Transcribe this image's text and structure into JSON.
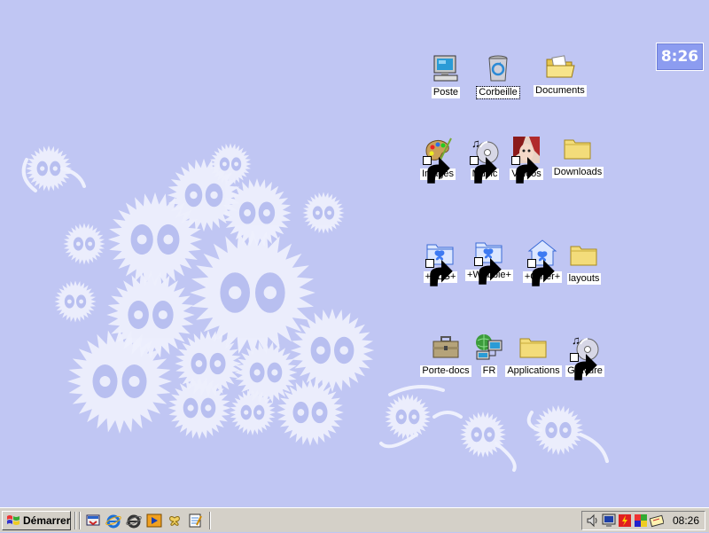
{
  "desktop": {
    "background_color": "#c0c6f3",
    "clock_widget": {
      "time": "8:26"
    },
    "icons": [
      {
        "id": "poste",
        "label": "Poste",
        "icon": "computer-icon",
        "shortcut": false
      },
      {
        "id": "corbeille",
        "label": "Corbeille",
        "icon": "recycle-bin-icon",
        "shortcut": false,
        "focused": true
      },
      {
        "id": "documents",
        "label": "Documents",
        "icon": "folder-open-icon",
        "shortcut": false
      },
      {
        "id": "images",
        "label": "Images",
        "icon": "palette-icon",
        "shortcut": true
      },
      {
        "id": "music",
        "label": "Music",
        "icon": "music-cd-icon",
        "shortcut": true
      },
      {
        "id": "videos",
        "label": "Videos",
        "icon": "video-face-icon",
        "shortcut": true
      },
      {
        "id": "downloads",
        "label": "Downloads",
        "icon": "folder-icon",
        "shortcut": false
      },
      {
        "id": "slg",
        "label": "+SLG+",
        "icon": "butterfly-folder-icon",
        "shortcut": true
      },
      {
        "id": "webbie",
        "label": "+Webbie+",
        "icon": "butterfly-folder-icon",
        "shortcut": true
      },
      {
        "id": "other",
        "label": "+Other+",
        "icon": "butterfly-home-icon",
        "shortcut": true
      },
      {
        "id": "layouts",
        "label": "layouts",
        "icon": "folder-icon",
        "shortcut": false
      },
      {
        "id": "porte-docs",
        "label": "Porte-docs",
        "icon": "briefcase-icon",
        "shortcut": false
      },
      {
        "id": "fr",
        "label": "FR",
        "icon": "network-icon",
        "shortcut": false
      },
      {
        "id": "applications",
        "label": "Applications",
        "icon": "folder-icon",
        "shortcut": false
      },
      {
        "id": "gravure",
        "label": "Gravure",
        "icon": "music-cd-icon",
        "shortcut": true
      }
    ]
  },
  "taskbar": {
    "start_label": "Démarrer",
    "quick_launch": [
      {
        "name": "show-desktop-icon"
      },
      {
        "name": "internet-explorer-icon"
      },
      {
        "name": "internet-explorer-alt-icon"
      },
      {
        "name": "media-player-icon"
      },
      {
        "name": "butterfly-app-icon"
      },
      {
        "name": "notepad-icon"
      }
    ],
    "tray_icons": [
      {
        "name": "volume-icon"
      },
      {
        "name": "monitor-icon"
      },
      {
        "name": "flash-icon"
      },
      {
        "name": "color-blocks-icon"
      },
      {
        "name": "ticket-icon"
      }
    ],
    "time": "08:26"
  }
}
